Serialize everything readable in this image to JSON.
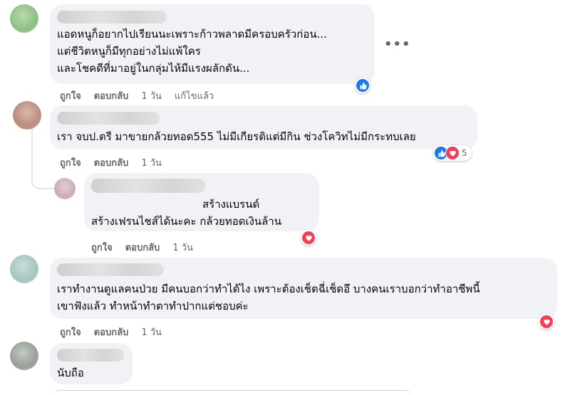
{
  "comments": [
    {
      "lines": [
        "แอดหนูก็อยากไปเรียนนะเพราะก้าวพลาดมีครอบครัวก่อน...",
        "แต่ชีวิตหนูก็มีทุกอย่างไม่แพ้ใคร",
        "และโชคดีที่มาอยู่ในกลุ่มไห้มีแรงผลักดัน..."
      ],
      "like": "ถูกใจ",
      "reply": "ตอบกลับ",
      "time": "1 วัน",
      "edited": "แก้ไขแล้ว",
      "more": "•••"
    },
    {
      "lines": [
        "เรา จบป.ตรี มาขายกล้วยทอด555 ไม่มีเกียรติแต่มีกิน ช่วงโควิทไม่มีกระทบเลย"
      ],
      "like": "ถูกใจ",
      "reply": "ตอบกลับ",
      "time": "1 วัน",
      "reaction_count": "5"
    },
    {
      "lines": [
        "สร้างแบรนด์",
        "สร้างเฟรนไชส์ได้นะคะ กล้วยทอดเงินล้าน"
      ],
      "like": "ถูกใจ",
      "reply": "ตอบกลับ",
      "time": "1 วัน"
    },
    {
      "lines": [
        "เราทำงานดูแลคนป่วย มีคนบอกว่าทำได้ไง เพราะต้องเช็ดฉี่เช็ดอึ บางคนเราบอกว่าทำอาชีพนี้",
        "เขาฟังแล้ว ทำหน้าทำตาทำปากแต่ชอบค่ะ"
      ],
      "like": "ถูกใจ",
      "reply": "ตอบกลับ",
      "time": "1 วัน"
    },
    {
      "lines": [
        "นับถือ"
      ]
    }
  ],
  "colors": {
    "bubble": "#f0f2f5",
    "like": "#1877f2",
    "love": "#f33e58",
    "meta": "#65676b"
  }
}
